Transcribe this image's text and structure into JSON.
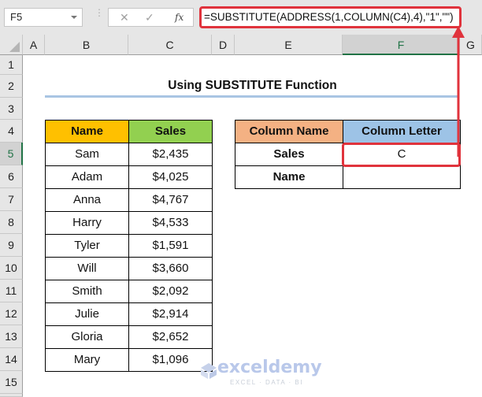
{
  "app": "Microsoft Excel",
  "formula_bar": {
    "name_box": "F5",
    "cancel_icon": "✕",
    "enter_icon": "✓",
    "fx_label": "fx",
    "formula": "=SUBSTITUTE(ADDRESS(1,COLUMN(C4),4),\"1\",\"\")"
  },
  "columns": [
    "A",
    "B",
    "C",
    "D",
    "E",
    "F",
    "G"
  ],
  "selected_column": "F",
  "rows": [
    "1",
    "2",
    "3",
    "4",
    "5",
    "6",
    "7",
    "8",
    "9",
    "10",
    "11",
    "12",
    "13",
    "14",
    "15"
  ],
  "selected_row": "5",
  "sheet": {
    "title": "Using SUBSTITUTE Function",
    "data_table": {
      "headers": [
        "Name",
        "Sales"
      ],
      "header_colors": [
        "#ffc000",
        "#92d050"
      ],
      "rows": [
        [
          "Sam",
          "$2,435"
        ],
        [
          "Adam",
          "$4,025"
        ],
        [
          "Anna",
          "$4,767"
        ],
        [
          "Harry",
          "$4,533"
        ],
        [
          "Tyler",
          "$1,591"
        ],
        [
          "Will",
          "$3,660"
        ],
        [
          "Smith",
          "$2,092"
        ],
        [
          "Julie",
          "$2,914"
        ],
        [
          "Gloria",
          "$2,652"
        ],
        [
          "Mary",
          "$1,096"
        ]
      ]
    },
    "result_table": {
      "headers": [
        "Column Name",
        "Column Letter"
      ],
      "header_colors": [
        "#f4b183",
        "#9dc3e6"
      ],
      "rows": [
        [
          "Sales",
          "C"
        ],
        [
          "Name",
          ""
        ]
      ]
    }
  },
  "highlight_color": "#e0333c",
  "watermark": {
    "brand": "exceldemy",
    "tagline": "EXCEL · DATA · BI"
  }
}
